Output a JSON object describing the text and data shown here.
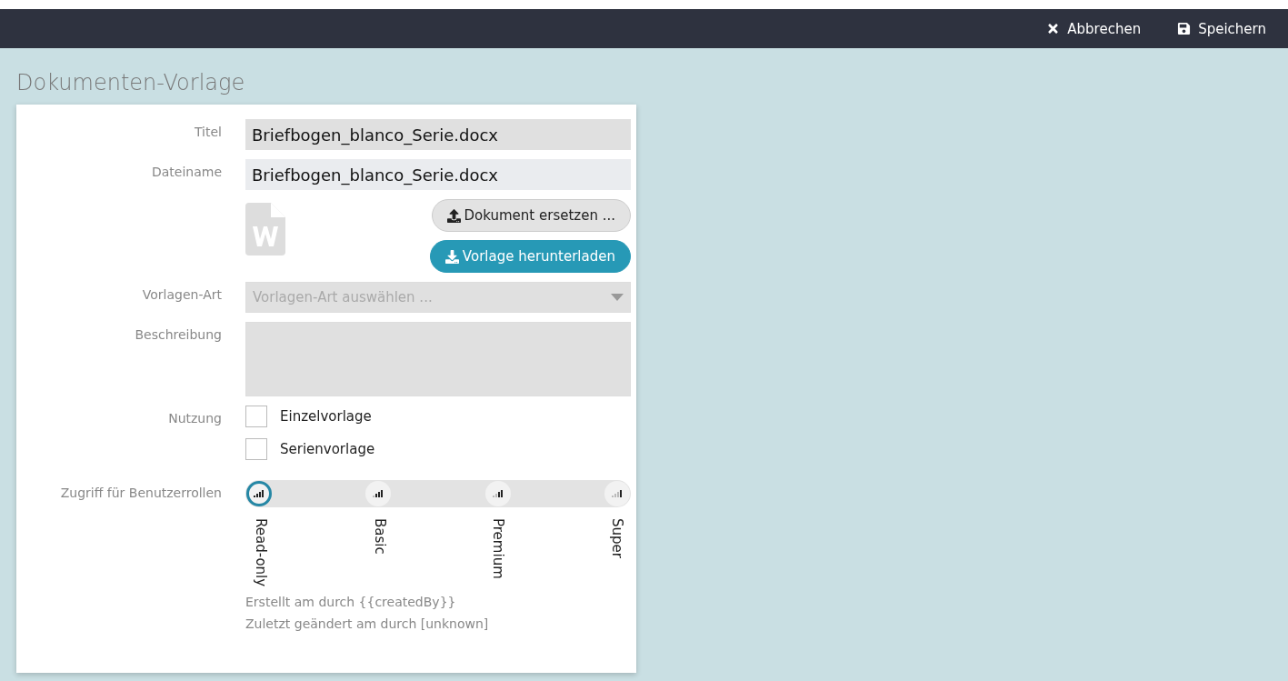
{
  "toolbar": {
    "buttons": [
      {
        "kind": "cancel",
        "label": "Abbrechen"
      },
      {
        "kind": "save",
        "label": "Speichern"
      }
    ]
  },
  "page_title": "Dokumenten-Vorlage",
  "form": {
    "title": {
      "label": "Titel",
      "value": "Briefbogen_blanco_Serie.docx"
    },
    "filename": {
      "label": "Dateiname",
      "value": "Briefbogen_blanco_Serie.docx"
    },
    "replace_button": "Dokument ersetzen ...",
    "download_button": "Vorlage herunterladen",
    "template_type": {
      "label": "Vorlagen-Art",
      "placeholder": "Vorlagen-Art auswählen ..."
    },
    "description": {
      "label": "Beschreibung"
    },
    "usage": {
      "label": "Nutzung",
      "options": [
        {
          "label": "Einzelvorlage",
          "checked": false
        },
        {
          "label": "Serienvorlage",
          "checked": false
        }
      ]
    },
    "roles": {
      "label": "Zugriff für Benutzerrollen",
      "items": [
        {
          "label": "Read-only",
          "selected": true
        },
        {
          "label": "Basic",
          "selected": false
        },
        {
          "label": "Premium",
          "selected": false
        },
        {
          "label": "Super",
          "selected": false
        }
      ]
    },
    "meta": [
      "Erstellt am durch {{createdBy}}",
      "Zuletzt geändert am durch [unknown]"
    ]
  }
}
